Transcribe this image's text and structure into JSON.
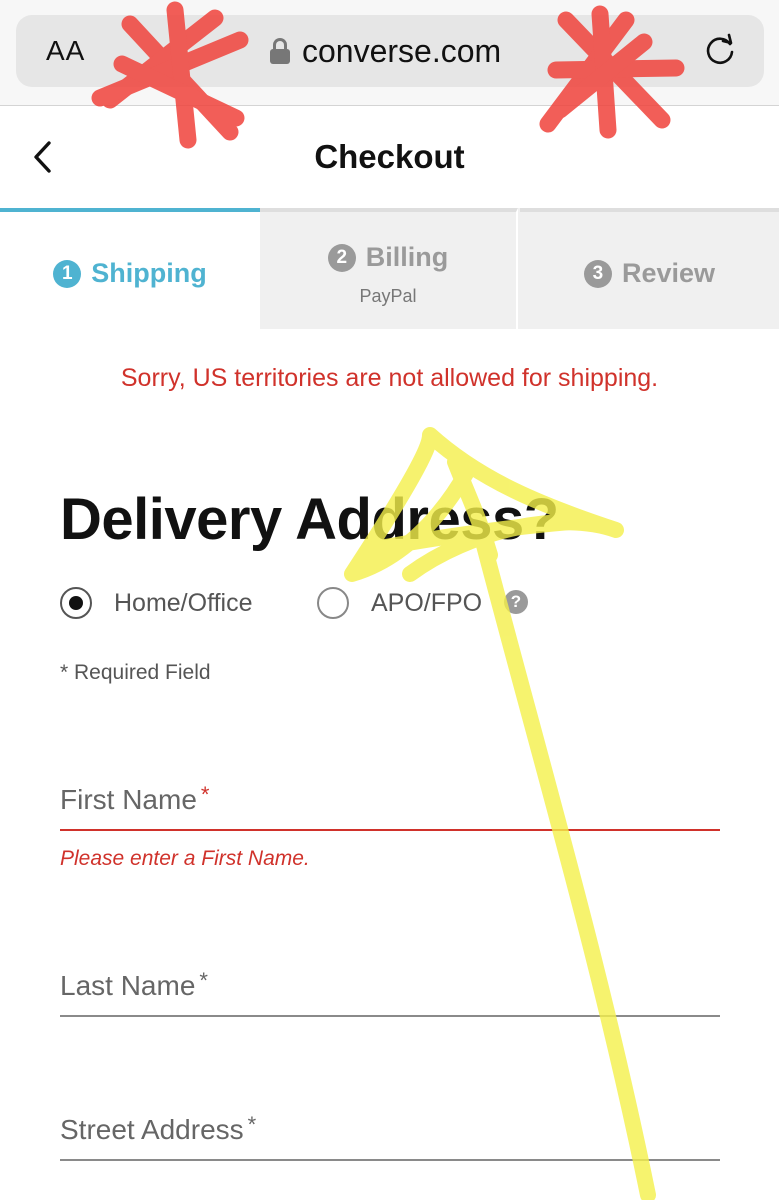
{
  "browser": {
    "text_size_label": "AA",
    "url": "converse.com"
  },
  "header": {
    "title": "Checkout"
  },
  "steps": [
    {
      "number": "1",
      "label": "Shipping",
      "sub": ""
    },
    {
      "number": "2",
      "label": "Billing",
      "sub": "PayPal"
    },
    {
      "number": "3",
      "label": "Review",
      "sub": ""
    }
  ],
  "alert": {
    "message": "Sorry, US territories are not allowed for shipping."
  },
  "form": {
    "heading": "Delivery Address?",
    "address_types": [
      {
        "label": "Home/Office",
        "checked": true
      },
      {
        "label": "APO/FPO",
        "checked": false
      }
    ],
    "help_glyph": "?",
    "required_note": "* Required Field",
    "fields": [
      {
        "label": "First Name",
        "required_mark": "*",
        "error": "Please enter a First Name."
      },
      {
        "label": "Last Name",
        "required_mark": "*",
        "error": ""
      },
      {
        "label": "Street Address",
        "required_mark": "*",
        "error": ""
      }
    ]
  },
  "colors": {
    "accent": "#4fb3d1",
    "error": "#d0322b",
    "inactive": "#9a9a9a",
    "scribble_red": "#f0433c",
    "highlighter_yellow": "#f4f04a"
  }
}
